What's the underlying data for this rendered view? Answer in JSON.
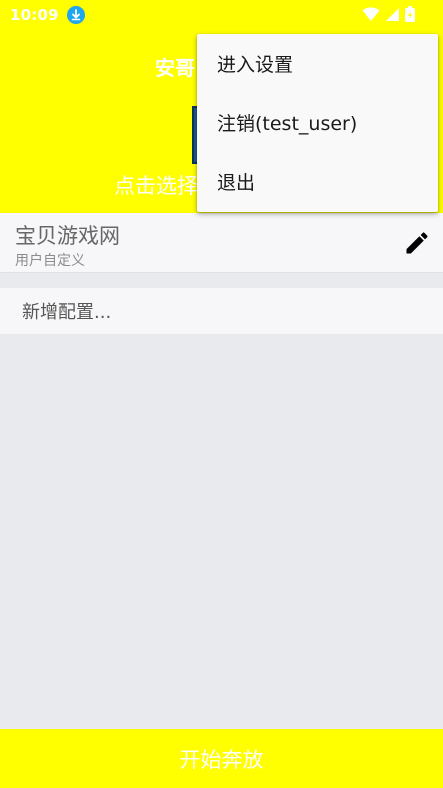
{
  "status_bar": {
    "time": "10:09",
    "icons": [
      "download-icon",
      "wifi-icon",
      "signal-icon",
      "battery-icon"
    ]
  },
  "header": {
    "title": "安哥",
    "select_hint": "点击选择"
  },
  "config_list": {
    "items": [
      {
        "name": "宝贝游戏网",
        "subtitle": "用户自定义",
        "action_icon": "edit-icon"
      }
    ],
    "add_label": "新增配置..."
  },
  "menu": {
    "items": [
      {
        "label": "进入设置"
      },
      {
        "label": "注销(test_user)"
      },
      {
        "label": "退出"
      }
    ]
  },
  "bottom": {
    "start_label": "开始奔放"
  },
  "colors": {
    "accent_yellow": "#ffff00",
    "background": "#e9eaee",
    "card": "#f7f7f9",
    "download_badge": "#1ea7f0"
  }
}
